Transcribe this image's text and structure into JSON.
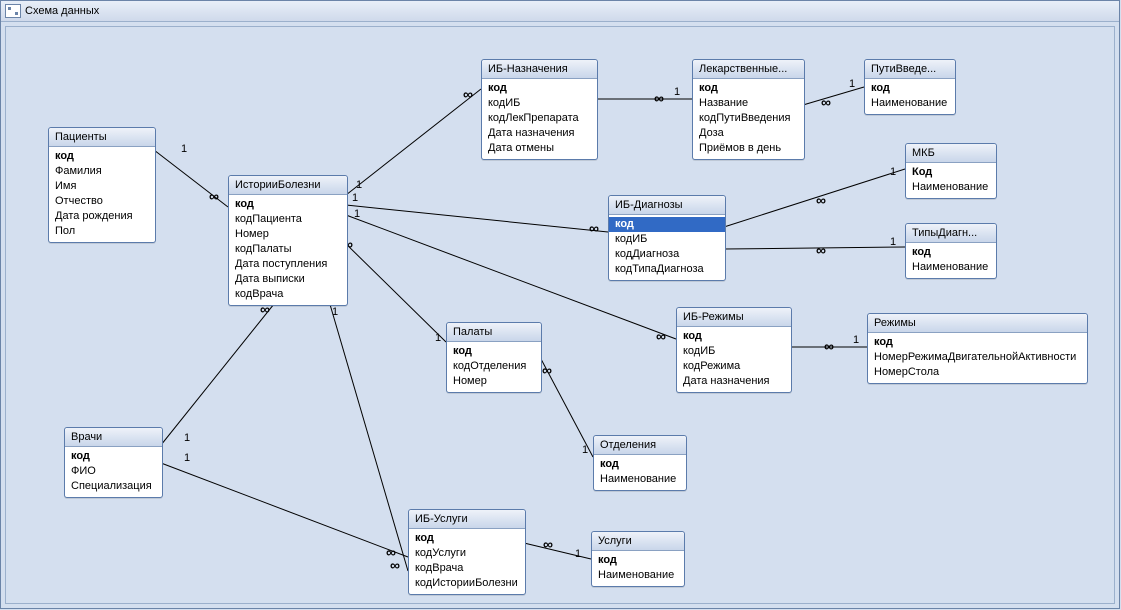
{
  "window": {
    "title": "Схема данных"
  },
  "cardinality": {
    "one": "1",
    "many": "∞"
  },
  "tables": {
    "patients": {
      "title": "Пациенты",
      "fields": [
        {
          "name": "код",
          "pk": true
        },
        {
          "name": "Фамилия"
        },
        {
          "name": "Имя"
        },
        {
          "name": "Отчество"
        },
        {
          "name": "Дата рождения"
        },
        {
          "name": "Пол"
        }
      ]
    },
    "ib": {
      "title": "ИсторииБолезни",
      "fields": [
        {
          "name": "код",
          "pk": true
        },
        {
          "name": "кодПациента"
        },
        {
          "name": "Номер"
        },
        {
          "name": "кодПалаты"
        },
        {
          "name": "Дата поступления"
        },
        {
          "name": "Дата выписки"
        },
        {
          "name": "кодВрача"
        }
      ]
    },
    "doctors": {
      "title": "Врачи",
      "fields": [
        {
          "name": "код",
          "pk": true
        },
        {
          "name": "ФИО"
        },
        {
          "name": "Специализация"
        }
      ]
    },
    "ib_nazn": {
      "title": "ИБ-Назначения",
      "fields": [
        {
          "name": "код",
          "pk": true
        },
        {
          "name": "кодИБ"
        },
        {
          "name": "кодЛекПрепарата"
        },
        {
          "name": "Дата назначения"
        },
        {
          "name": "Дата отмены"
        }
      ]
    },
    "lek": {
      "title": "Лекарственные...",
      "fields": [
        {
          "name": "код",
          "pk": true
        },
        {
          "name": "Название"
        },
        {
          "name": "кодПутиВведения"
        },
        {
          "name": "Доза"
        },
        {
          "name": "Приёмов в день"
        }
      ]
    },
    "puti": {
      "title": "ПутиВведе...",
      "fields": [
        {
          "name": "код",
          "pk": true
        },
        {
          "name": "Наименование"
        }
      ]
    },
    "mkb": {
      "title": "МКБ",
      "fields": [
        {
          "name": "Код",
          "pk": true
        },
        {
          "name": "Наименование"
        }
      ]
    },
    "tipydiag": {
      "title": "ТипыДиагн...",
      "fields": [
        {
          "name": "код",
          "pk": true
        },
        {
          "name": "Наименование"
        }
      ]
    },
    "ib_diag": {
      "title": "ИБ-Диагнозы",
      "fields": [
        {
          "name": "код",
          "pk": true,
          "selected": true
        },
        {
          "name": "кодИБ"
        },
        {
          "name": "кодДиагноза"
        },
        {
          "name": "кодТипаДиагноза"
        }
      ]
    },
    "ib_rezh": {
      "title": "ИБ-Режимы",
      "fields": [
        {
          "name": "код",
          "pk": true
        },
        {
          "name": "кодИБ"
        },
        {
          "name": "кодРежима"
        },
        {
          "name": "Дата назначения"
        }
      ]
    },
    "rezhimy": {
      "title": "Режимы",
      "fields": [
        {
          "name": "код",
          "pk": true
        },
        {
          "name": "НомерРежимаДвигательнойАктивности"
        },
        {
          "name": "НомерСтола"
        }
      ]
    },
    "palaty": {
      "title": "Палаты",
      "fields": [
        {
          "name": "код",
          "pk": true
        },
        {
          "name": "кодОтделения"
        },
        {
          "name": "Номер"
        }
      ]
    },
    "otdel": {
      "title": "Отделения",
      "fields": [
        {
          "name": "код",
          "pk": true
        },
        {
          "name": "Наименование"
        }
      ]
    },
    "ib_uslugi": {
      "title": "ИБ-Услуги",
      "fields": [
        {
          "name": "код",
          "pk": true
        },
        {
          "name": "кодУслуги"
        },
        {
          "name": "кодВрача"
        },
        {
          "name": "кодИсторииБолезни"
        }
      ]
    },
    "uslugi": {
      "title": "Услуги",
      "fields": [
        {
          "name": "код",
          "pk": true
        },
        {
          "name": "Наименование"
        }
      ]
    }
  },
  "relationships": [
    {
      "from": "patients",
      "to": "ib",
      "from_card": "1",
      "to_card": "∞"
    },
    {
      "from": "doctors",
      "to": "ib",
      "from_card": "1",
      "to_card": "∞"
    },
    {
      "from": "doctors",
      "to": "ib_uslugi",
      "from_card": "1",
      "to_card": "∞"
    },
    {
      "from": "ib",
      "to": "ib_nazn",
      "from_card": "1",
      "to_card": "∞"
    },
    {
      "from": "ib",
      "to": "ib_diag",
      "from_card": "1",
      "to_card": "∞"
    },
    {
      "from": "ib",
      "to": "ib_rezh",
      "from_card": "1",
      "to_card": "∞"
    },
    {
      "from": "ib",
      "to": "palaty",
      "from_card": "∞",
      "to_card": "1"
    },
    {
      "from": "ib",
      "to": "ib_uslugi",
      "from_card": "1",
      "to_card": "∞"
    },
    {
      "from": "ib_nazn",
      "to": "lek",
      "from_card": "∞",
      "to_card": "1"
    },
    {
      "from": "lek",
      "to": "puti",
      "from_card": "∞",
      "to_card": "1"
    },
    {
      "from": "ib_diag",
      "to": "mkb",
      "from_card": "∞",
      "to_card": "1"
    },
    {
      "from": "ib_diag",
      "to": "tipydiag",
      "from_card": "∞",
      "to_card": "1"
    },
    {
      "from": "ib_rezh",
      "to": "rezhimy",
      "from_card": "∞",
      "to_card": "1"
    },
    {
      "from": "palaty",
      "to": "otdel",
      "from_card": "∞",
      "to_card": "1"
    },
    {
      "from": "ib_uslugi",
      "to": "uslugi",
      "from_card": "∞",
      "to_card": "1"
    }
  ]
}
